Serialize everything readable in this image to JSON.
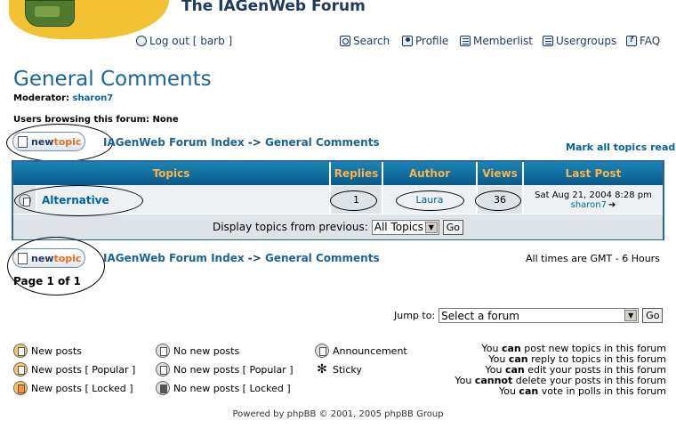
{
  "header": {
    "site_title": "The IAGenWeb Forum",
    "nav": {
      "logout": "Log out [ barb ]",
      "search": "Search",
      "profile": "Profile",
      "memberlist": "Memberlist",
      "usergroups": "Usergroups",
      "faq": "FAQ"
    }
  },
  "forum": {
    "title": "General Comments",
    "moderator_label": "Moderator:",
    "moderator_name": "sharon7",
    "users_browsing": "Users browsing this forum: None",
    "new_topic_a": "new",
    "new_topic_b": "topic",
    "breadcrumb_index": "IAGenWeb Forum Index",
    "breadcrumb_sep": "->",
    "breadcrumb_current": "General Comments",
    "mark_all": "Mark all topics read"
  },
  "table": {
    "headers": [
      "Topics",
      "Replies",
      "Author",
      "Views",
      "Last Post"
    ],
    "row": {
      "topic": "Alternative",
      "replies": "1",
      "author": "Laura",
      "views": "36",
      "last_post_date": "Sat Aug 21, 2004 8:28 pm",
      "last_post_user": "sharon7"
    },
    "display_label": "Display topics from previous:",
    "display_value": "All Topics",
    "go": "Go"
  },
  "bottom": {
    "timezone": "All times are GMT - 6 Hours",
    "page_info": "Page 1 of 1",
    "jump_label": "Jump to:",
    "jump_value": "Select a forum",
    "go": "Go"
  },
  "legend": {
    "new_posts": "New posts",
    "new_popular": "New posts [ Popular ]",
    "new_locked": "New posts [ Locked ]",
    "no_new": "No new posts",
    "no_new_popular": "No new posts [ Popular ]",
    "no_new_locked": "No new posts [ Locked ]",
    "announcement": "Announcement",
    "sticky": "Sticky"
  },
  "permissions": [
    {
      "pre": "You ",
      "bold": "can",
      "post": " post new topics in this forum"
    },
    {
      "pre": "You ",
      "bold": "can",
      "post": " reply to topics in this forum"
    },
    {
      "pre": "You ",
      "bold": "can",
      "post": " edit your posts in this forum"
    },
    {
      "pre": "You ",
      "bold": "cannot",
      "post": " delete your posts in this forum"
    },
    {
      "pre": "You ",
      "bold": "can",
      "post": " vote in polls in this forum"
    }
  ],
  "footer": "Powered by phpBB © 2001, 2005 phpBB Group"
}
